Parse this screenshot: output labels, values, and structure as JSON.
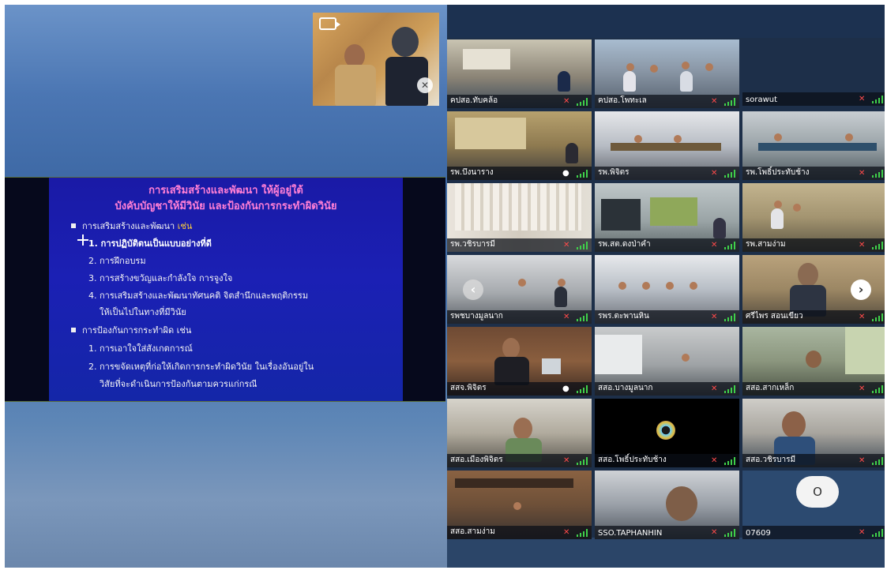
{
  "slide": {
    "title_line1": "การเสริมสร้างและพัฒนา ให้ผู้อยู่ใต้",
    "title_line2": "บังคับบัญชาให้มีวินัย และป้องกันการกระทำผิดวินัย",
    "section1_heading": "การเสริมสร้างและพัฒนา",
    "section1_suffix": "เช่น",
    "section1_items": [
      "1. การปฏิบัติตนเป็นแบบอย่างที่ดี",
      "2. การฝึกอบรม",
      "3. การสร้างขวัญและกำลังใจ  การจูงใจ",
      "4. การเสริมสร้างและพัฒนาทัศนคติ จิตสำนึกและพฤติกรรม",
      "ให้เป็นไปในทางที่มีวินัย"
    ],
    "section2_heading": "การป้องกันการกระทำผิด เช่น",
    "section2_items": [
      "1. การเอาใจใส่สังเกตการณ์",
      "2. การขจัดเหตุที่ก่อให้เกิดการกระทำผิดวินัย ในเรื่องอันอยู่ใน",
      "วิสัยที่จะดำเนินการป้องกันตามควรแก่กรณี"
    ]
  },
  "self_view": {
    "name": "sorawut",
    "icon_camera": "camera-switch-icon",
    "icon_mic": "mic-muted-icon"
  },
  "participants": [
    {
      "name": "คปสอ.ทับคล้อ",
      "muted": true
    },
    {
      "name": "คปสอ.โพทะเล",
      "muted": true
    },
    {
      "name": "รพ.บึงนาราง",
      "muted": false
    },
    {
      "name": "รพ.พิจิตร",
      "muted": true
    },
    {
      "name": "รพ.โพธิ์ประทับช้าง",
      "muted": true
    },
    {
      "name": "รพ.วชิรบารมี",
      "muted": true
    },
    {
      "name": "รพ.สต.ดงป่าคำ",
      "muted": true
    },
    {
      "name": "รพ.สามง่าม",
      "muted": true
    },
    {
      "name": "รพชบางมูลนาก",
      "muted": true
    },
    {
      "name": "รพร.ตะพานหิน",
      "muted": true
    },
    {
      "name": "ศรีไพร สอนเขียว",
      "muted": true
    },
    {
      "name": "สสจ.พิจิตร",
      "muted": false
    },
    {
      "name": "สสอ.บางมูลนาก",
      "muted": true
    },
    {
      "name": "สสอ.สากเหล็ก",
      "muted": true
    },
    {
      "name": "สสอ.เมืองพิจิตร",
      "muted": true
    },
    {
      "name": "สสอ.โพธิ์ประทับช้าง",
      "muted": true
    },
    {
      "name": "สสอ.วชิรบารมี",
      "muted": true
    },
    {
      "name": "สสอ.สามง่าม",
      "muted": true
    },
    {
      "name": "SSO.TAPHANHIN",
      "muted": true
    },
    {
      "name": "07609",
      "muted": true
    }
  ],
  "avatar_initial": "O",
  "nav": {
    "prev": "‹",
    "next": "›"
  },
  "colors": {
    "signal": "#3fd04a",
    "muted": "#ff4a4a",
    "slide_title": "#ff7fd6"
  }
}
